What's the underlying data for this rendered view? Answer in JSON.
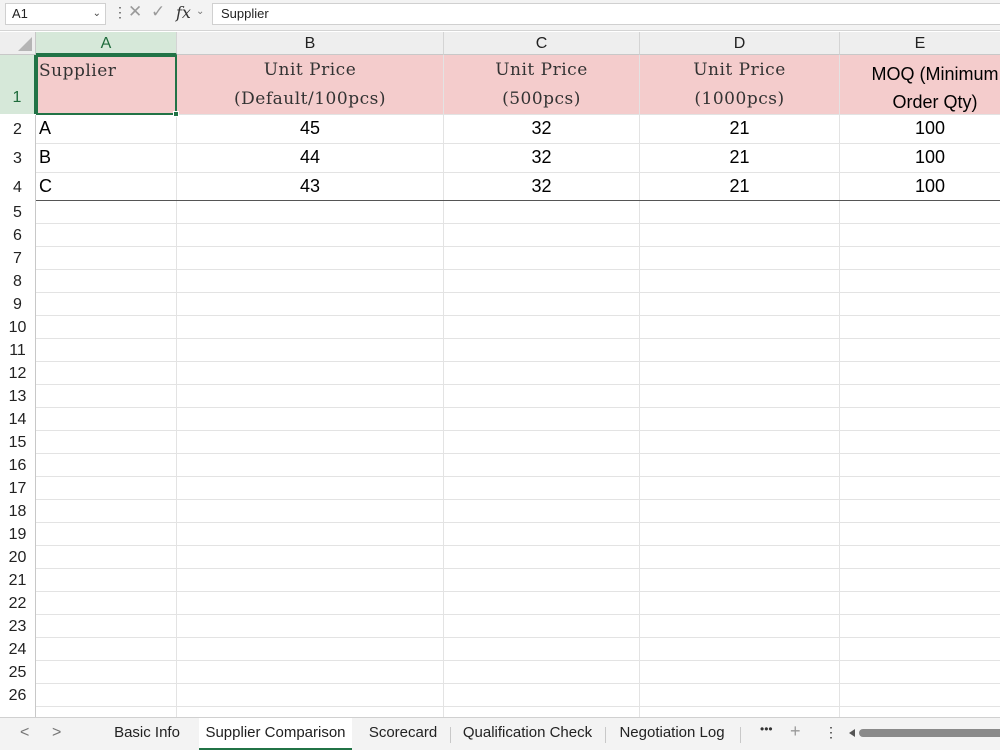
{
  "formula_bar": {
    "cell_ref": "A1",
    "fx_label": "fx",
    "content": "Supplier"
  },
  "columns": [
    "A",
    "B",
    "C",
    "D",
    "E"
  ],
  "rows": [
    "1",
    "2",
    "3",
    "4",
    "5",
    "6",
    "7",
    "8",
    "9",
    "10",
    "11",
    "12",
    "13",
    "14",
    "15",
    "16",
    "17",
    "18",
    "19",
    "20",
    "21",
    "22",
    "23",
    "24",
    "25",
    "26"
  ],
  "table": {
    "headers": {
      "a": "Supplier",
      "b1": "Unit Price",
      "b2": "(Default/100pcs)",
      "c1": "Unit Price",
      "c2": "(500pcs)",
      "d1": "Unit Price",
      "d2": "(1000pcs)",
      "e1": "MOQ (Minimum",
      "e2": "Order Qty)"
    },
    "rows": [
      {
        "supplier": "A",
        "price_100": "45",
        "price_500": "32",
        "price_1000": "21",
        "moq": "100"
      },
      {
        "supplier": "B",
        "price_100": "44",
        "price_500": "32",
        "price_1000": "21",
        "moq": "100"
      },
      {
        "supplier": "C",
        "price_100": "43",
        "price_500": "32",
        "price_1000": "21",
        "moq": "100"
      }
    ]
  },
  "sheets": {
    "tabs": [
      "Basic Info",
      "Supplier Comparison",
      "Scorecard",
      "Qualification Check",
      "Negotiation Log"
    ],
    "active": "Supplier Comparison",
    "more": "•••",
    "add": "+",
    "menu": "⋮"
  },
  "colors": {
    "header_fill": "#f4cccc",
    "selection": "#217346"
  },
  "icons": {
    "cancel": "✕",
    "confirm": "✓",
    "prev": "<",
    "next": ">"
  }
}
